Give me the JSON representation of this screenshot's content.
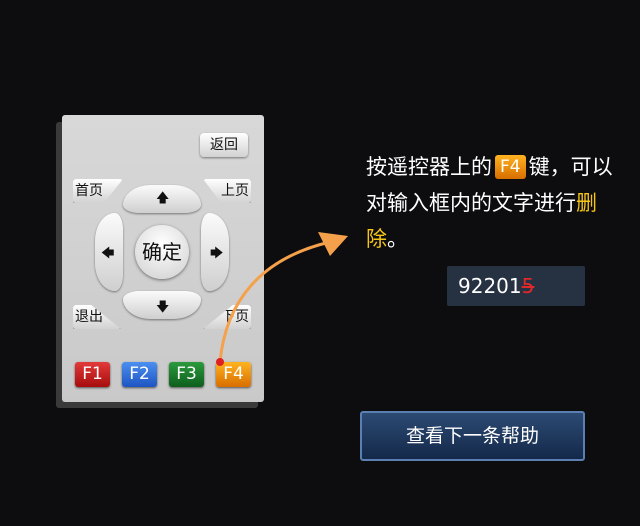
{
  "remote": {
    "back_label": "返回",
    "home_label": "首页",
    "page_up_label": "上页",
    "quit_label": "退出",
    "page_down_label": "下页",
    "ok_label": "确定",
    "arrows": {
      "up": "🡅",
      "down": "🡇",
      "left": "🡄",
      "right": "🡆"
    },
    "fkeys": [
      "F1",
      "F2",
      "F3",
      "F4"
    ]
  },
  "instruction": {
    "part1": "按遥控器上的",
    "key": "F4",
    "part2": "键，可以对输入框内的文字进行",
    "highlight": "删除",
    "part3": "。"
  },
  "demo_input": {
    "kept_text": "92201",
    "deleted_char": "5"
  },
  "next_help_button": "查看下一条帮助",
  "colors": {
    "background": "#0d0d0f",
    "highlight": "#f5c518",
    "f1": "#c11d1d",
    "f2": "#2f6fd8",
    "f3": "#1b7a2c",
    "f4": "#f08c10",
    "curve": "#f5a04a"
  }
}
